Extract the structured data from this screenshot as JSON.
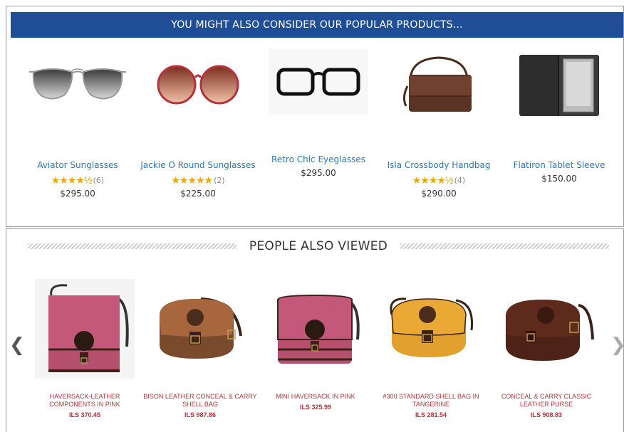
{
  "popular": {
    "header": "YOU MIGHT ALSO CONSIDER OUR POPULAR PRODUCTS...",
    "products": [
      {
        "name": "Aviator Sunglasses",
        "stars": "★★★★½",
        "rating_count": "(6)",
        "price": "$295.00",
        "icon": "aviator-sunglasses-image"
      },
      {
        "name": "Jackie O Round Sunglasses",
        "stars": "★★★★★",
        "rating_count": "(2)",
        "price": "$225.00",
        "icon": "round-sunglasses-image"
      },
      {
        "name": "Retro Chic Eyeglasses",
        "stars": "",
        "rating_count": "",
        "price": "$295.00",
        "icon": "eyeglasses-image"
      },
      {
        "name": "Isla Crossbody Handbag",
        "stars": "★★★★½",
        "rating_count": "(4)",
        "price": "$290.00",
        "icon": "crossbody-handbag-image"
      },
      {
        "name": "Flatiron Tablet Sleeve",
        "stars": "",
        "rating_count": "",
        "price": "$150.00",
        "icon": "tablet-sleeve-image"
      }
    ]
  },
  "viewed": {
    "title": "PEOPLE ALSO VIEWED",
    "prev": "❮",
    "next": "❯",
    "products": [
      {
        "name": "HAVERSACK-LEATHER COMPONENTS IN PINK",
        "price": "ILS 370.45",
        "icon": "pink-haversack-image"
      },
      {
        "name": "BISON LEATHER CONCEAL & CARRY SHELL BAG",
        "price": "ILS 987.86",
        "icon": "bison-shell-bag-image"
      },
      {
        "name": "MINI HAVERSACK IN PINK",
        "price": "ILS 325.99",
        "icon": "mini-pink-haversack-image"
      },
      {
        "name": "#300 STANDARD SHELL BAG IN TANGERINE",
        "price": "ILS 281.54",
        "icon": "tangerine-shell-bag-image"
      },
      {
        "name": "CONCEAL & CARRY CLASSIC LEATHER PURSE",
        "price": "ILS 908.83",
        "icon": "leather-purse-image"
      }
    ]
  },
  "colors": {
    "header_bg": "#1f4e97",
    "link": "#2a7ab5",
    "star": "#f0a500",
    "viewed_text": "#b1353a"
  }
}
